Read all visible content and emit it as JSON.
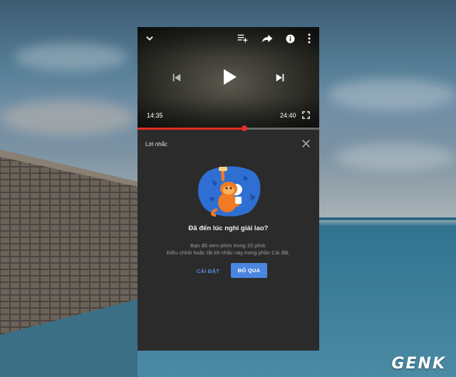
{
  "player": {
    "elapsed": "14:35",
    "duration": "24:40",
    "progress_fraction": 0.59,
    "icons": [
      "chevron-down-icon",
      "add-to-queue-icon",
      "share-icon",
      "info-icon",
      "more-vert-icon",
      "skip-previous-icon",
      "play-icon",
      "skip-next-icon",
      "fullscreen-icon"
    ]
  },
  "reminder": {
    "section_title": "Lời nhắc",
    "headline": "Đã đến lúc nghỉ giải lao?",
    "body_line1": "Bạn đã xem phim trong 15 phút.",
    "body_line2": "Điều chỉnh hoặc tắt lời nhắc này trong phần Cài đặt.",
    "settings_label": "CÀI ĐẶT",
    "dismiss_label": "BỎ QUA"
  },
  "watermark": "GENK",
  "colors": {
    "accent_blue": "#4a86e0",
    "progress_red": "#e52d27",
    "panel_bg": "#2b2b2b"
  }
}
